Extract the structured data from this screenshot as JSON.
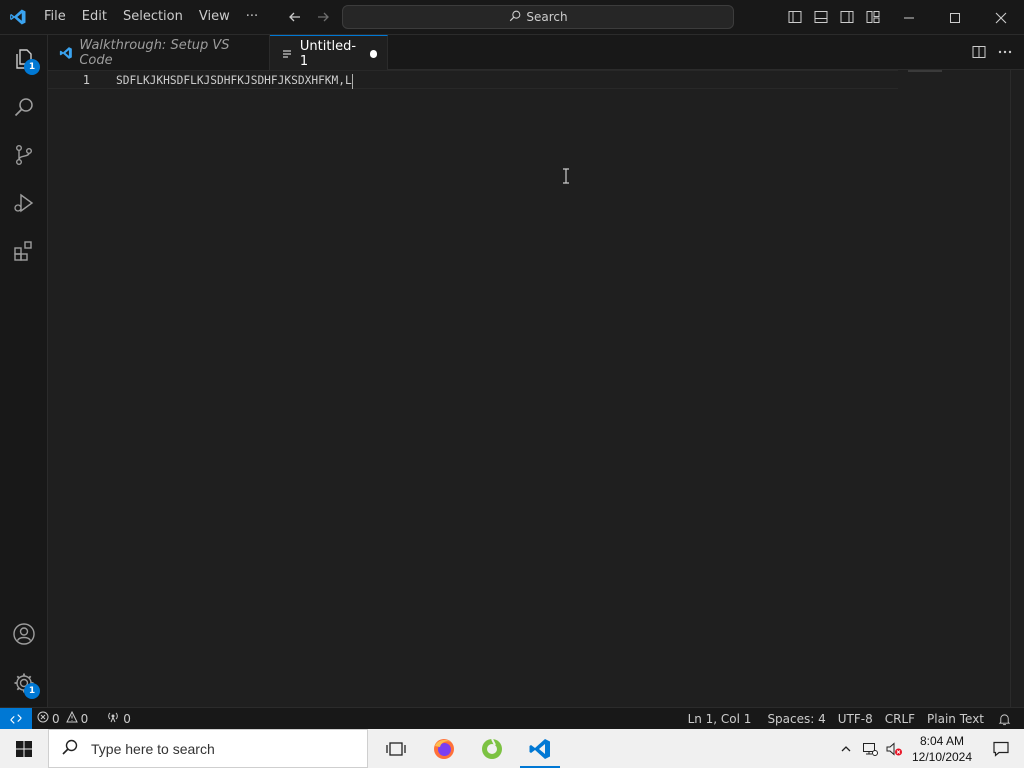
{
  "titlebar": {
    "menu": [
      "File",
      "Edit",
      "Selection",
      "View"
    ],
    "more_label": "···",
    "search_label": "Search"
  },
  "activity": {
    "explorer_badge": "1",
    "manage_badge": "1"
  },
  "tabs": [
    {
      "label": "Walkthrough: Setup VS Code",
      "active": false
    },
    {
      "label": "Untitled-1",
      "active": true,
      "dirty": true
    }
  ],
  "editor": {
    "line_number": "1",
    "line_text": "SDFLKJKHSDFLKJSDHFKJSDHFJKSDXHFKM,L"
  },
  "status": {
    "errors": "0",
    "warnings": "0",
    "ports": "0",
    "position": "Ln 1, Col 1",
    "spaces": "Spaces: 4",
    "encoding": "UTF-8",
    "eol": "CRLF",
    "language": "Plain Text"
  },
  "taskbar": {
    "search_placeholder": "Type here to search",
    "time": "8:04 AM",
    "date": "12/10/2024"
  },
  "colors": {
    "accent": "#0078d4",
    "bg": "#1f1f1f",
    "chrome": "#181818"
  }
}
